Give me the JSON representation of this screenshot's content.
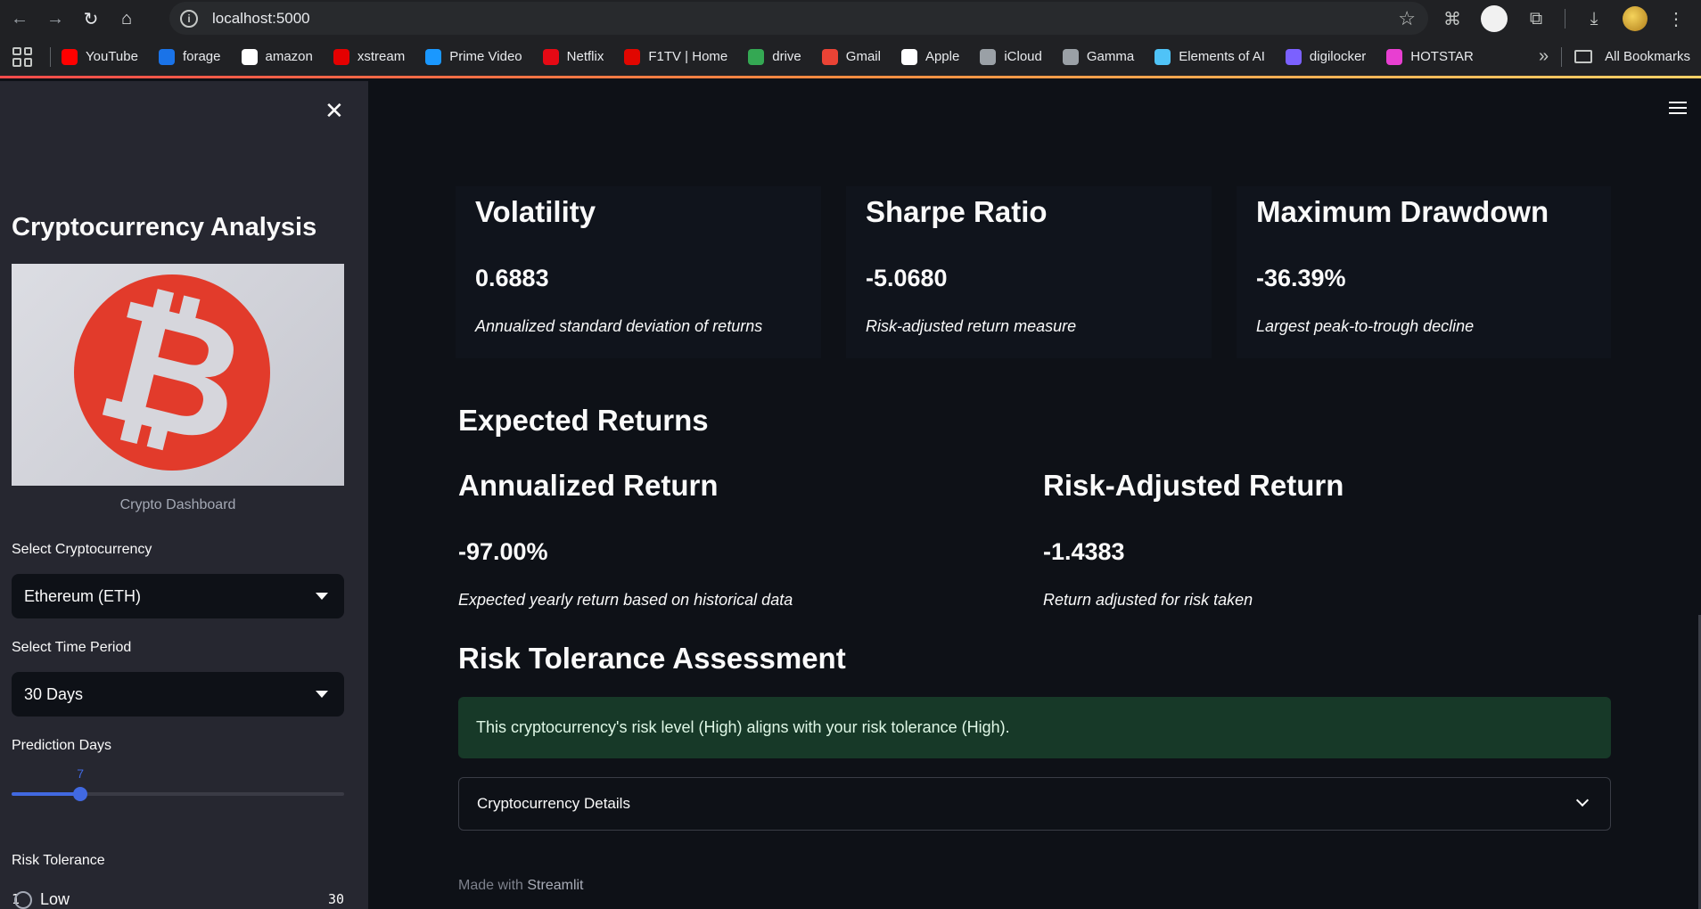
{
  "browser": {
    "url": "localhost:5000",
    "bookmarks": [
      {
        "label": "YouTube",
        "icon": "youtube-icon",
        "color": "#ff0000"
      },
      {
        "label": "forage",
        "icon": "forage-icon",
        "color": "#1a73e8"
      },
      {
        "label": "amazon",
        "icon": "amazon-icon",
        "color": "#ffffff"
      },
      {
        "label": "xstream",
        "icon": "xstream-icon",
        "color": "#e40000"
      },
      {
        "label": "Prime Video",
        "icon": "prime-video-icon",
        "color": "#1a98ff"
      },
      {
        "label": "Netflix",
        "icon": "netflix-icon",
        "color": "#e50914"
      },
      {
        "label": "F1TV | Home",
        "icon": "f1tv-icon",
        "color": "#e10600"
      },
      {
        "label": "drive",
        "icon": "drive-icon",
        "color": "#34a853"
      },
      {
        "label": "Gmail",
        "icon": "gmail-icon",
        "color": "#ea4335"
      },
      {
        "label": "Apple",
        "icon": "apple-icon",
        "color": "#ffffff"
      },
      {
        "label": "iCloud",
        "icon": "icloud-apple-icon",
        "color": "#9aa0a6"
      },
      {
        "label": "Gamma",
        "icon": "gamma-icon",
        "color": "#9aa0a6"
      },
      {
        "label": "Elements of AI",
        "icon": "elements-of-ai-icon",
        "color": "#4fc3f7"
      },
      {
        "label": "digilocker",
        "icon": "digilocker-icon",
        "color": "#7b61ff"
      },
      {
        "label": "HOTSTAR",
        "icon": "hotstar-icon",
        "color": "#e83fd1"
      }
    ],
    "all_bookmarks": "All Bookmarks"
  },
  "sidebar": {
    "title": "Cryptocurrency Analysis",
    "image_caption": "Crypto Dashboard",
    "crypto_label": "Select Cryptocurrency",
    "crypto_value": "Ethereum (ETH)",
    "period_label": "Select Time Period",
    "period_value": "30 Days",
    "prediction_label": "Prediction Days",
    "prediction_value": "7",
    "prediction_min": "1",
    "prediction_max": "30",
    "risk_label": "Risk Tolerance",
    "risk_option_low": "Low"
  },
  "metrics": {
    "volatility": {
      "title": "Volatility",
      "value": "0.6883",
      "desc": "Annualized standard deviation of returns"
    },
    "sharpe": {
      "title": "Sharpe Ratio",
      "value": "-5.0680",
      "desc": "Risk-adjusted return measure"
    },
    "drawdown": {
      "title": "Maximum Drawdown",
      "value": "-36.39%",
      "desc": "Largest peak-to-trough decline"
    }
  },
  "expected_returns": {
    "heading": "Expected Returns",
    "annualized": {
      "title": "Annualized Return",
      "value": "-97.00%",
      "desc": "Expected yearly return based on historical data"
    },
    "risk_adjusted": {
      "title": "Risk-Adjusted Return",
      "value": "-1.4383",
      "desc": "Return adjusted for risk taken"
    }
  },
  "risk": {
    "heading": "Risk Tolerance Assessment",
    "message": "This cryptocurrency's risk level (High) aligns with your risk tolerance (High).",
    "details_label": "Cryptocurrency Details"
  },
  "footer": {
    "prefix": "Made with",
    "brand": "Streamlit"
  }
}
